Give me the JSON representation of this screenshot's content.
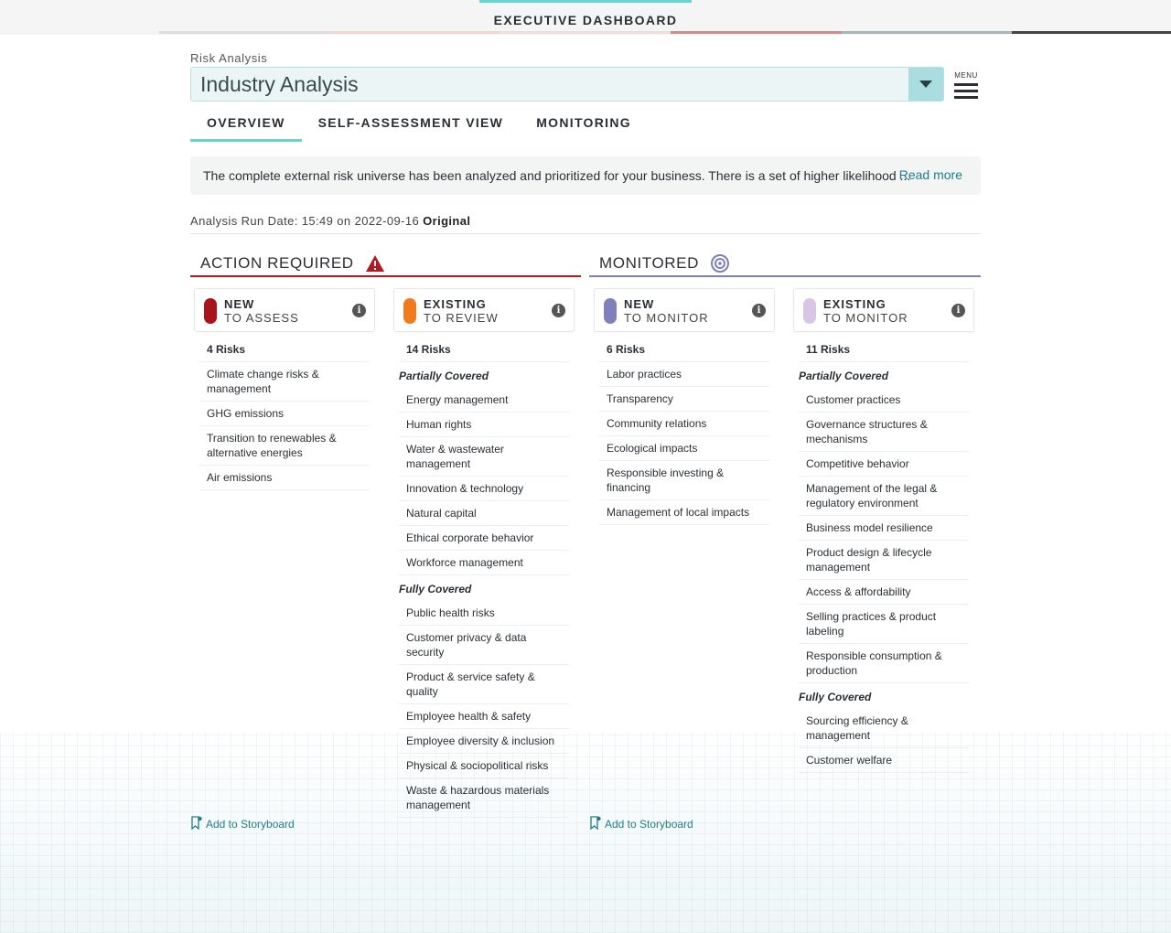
{
  "header": {
    "title": "EXECUTIVE DASHBOARD"
  },
  "breadcrumb": "Risk Analysis",
  "selector": {
    "value": "Industry Analysis"
  },
  "menu": {
    "label": "MENU"
  },
  "tabs": [
    {
      "label": "OVERVIEW",
      "active": true
    },
    {
      "label": "SELF-ASSESSMENT VIEW",
      "active": false
    },
    {
      "label": "MONITORING",
      "active": false
    }
  ],
  "summary": {
    "text": "The complete external risk universe has been analyzed and prioritized for your business. There is a set of higher likelihood ...",
    "read_more": "Read more"
  },
  "run_date": {
    "prefix": "Analysis Run Date: 15:49 on 2022-09-16",
    "status": "Original"
  },
  "sections": {
    "action": {
      "title": "ACTION REQUIRED",
      "color": "#b3181e"
    },
    "monitored": {
      "title": "MONITORED",
      "color": "#7d7fb8"
    }
  },
  "columns": [
    {
      "line1": "NEW",
      "line2": "TO ASSESS",
      "color": "#a8141a",
      "count": "4 Risks",
      "groups": [
        {
          "title": "",
          "items": [
            "Climate change risks & management",
            "GHG emissions",
            "Transition to renewables & alternative energies",
            "Air emissions"
          ]
        }
      ]
    },
    {
      "line1": "EXISTING",
      "line2": "TO REVIEW",
      "color": "#f17a1b",
      "count": "14 Risks",
      "groups": [
        {
          "title": "Partially Covered",
          "items": [
            "Energy management",
            "Human rights",
            "Water & wastewater management",
            "Innovation & technology",
            "Natural capital",
            "Ethical corporate behavior",
            "Workforce management"
          ]
        },
        {
          "title": "Fully Covered",
          "items": [
            "Public health risks",
            "Customer privacy & data security",
            "Product & service safety & quality",
            "Employee health & safety",
            "Employee diversity & inclusion",
            "Physical & sociopolitical risks",
            "Waste & hazardous materials management"
          ]
        }
      ]
    },
    {
      "line1": "NEW",
      "line2": "TO MONITOR",
      "color": "#8080bf",
      "count": "6 Risks",
      "groups": [
        {
          "title": "",
          "items": [
            "Labor practices",
            "Transparency",
            "Community relations",
            "Ecological impacts",
            "Responsible investing & financing",
            "Management of local impacts"
          ]
        }
      ]
    },
    {
      "line1": "EXISTING",
      "line2": "TO MONITOR",
      "color": "#d9c6e6",
      "count": "11 Risks",
      "groups": [
        {
          "title": "Partially Covered",
          "items": [
            "Customer practices",
            "Governance structures & mechanisms",
            "Competitive behavior",
            "Management of the legal & regulatory environment",
            "Business model resilience",
            "Product design & lifecycle management",
            "Access & affordability",
            "Selling practices & product labeling",
            "Responsible consumption & production"
          ]
        },
        {
          "title": "Fully Covered",
          "items": [
            "Sourcing efficiency & management",
            "Customer welfare"
          ]
        }
      ]
    }
  ],
  "storyboard": {
    "label": "Add to Storyboard"
  }
}
